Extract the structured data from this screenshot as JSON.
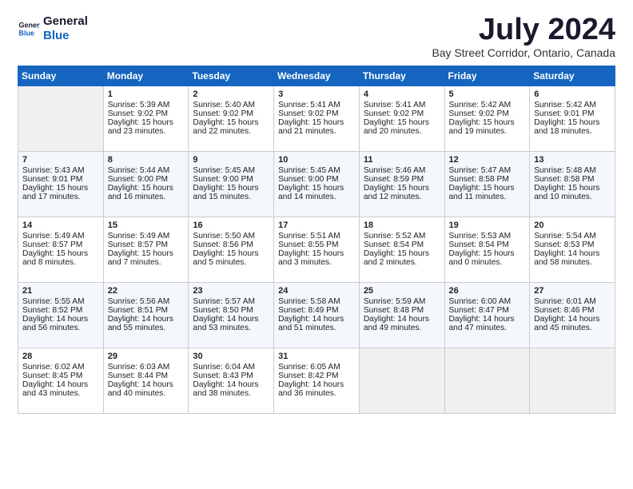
{
  "logo": {
    "line1": "General",
    "line2": "Blue"
  },
  "title": "July 2024",
  "location": "Bay Street Corridor, Ontario, Canada",
  "days_of_week": [
    "Sunday",
    "Monday",
    "Tuesday",
    "Wednesday",
    "Thursday",
    "Friday",
    "Saturday"
  ],
  "weeks": [
    [
      {
        "day": "",
        "content": ""
      },
      {
        "day": "1",
        "sunrise": "Sunrise: 5:39 AM",
        "sunset": "Sunset: 9:02 PM",
        "daylight": "Daylight: 15 hours and 23 minutes."
      },
      {
        "day": "2",
        "sunrise": "Sunrise: 5:40 AM",
        "sunset": "Sunset: 9:02 PM",
        "daylight": "Daylight: 15 hours and 22 minutes."
      },
      {
        "day": "3",
        "sunrise": "Sunrise: 5:41 AM",
        "sunset": "Sunset: 9:02 PM",
        "daylight": "Daylight: 15 hours and 21 minutes."
      },
      {
        "day": "4",
        "sunrise": "Sunrise: 5:41 AM",
        "sunset": "Sunset: 9:02 PM",
        "daylight": "Daylight: 15 hours and 20 minutes."
      },
      {
        "day": "5",
        "sunrise": "Sunrise: 5:42 AM",
        "sunset": "Sunset: 9:02 PM",
        "daylight": "Daylight: 15 hours and 19 minutes."
      },
      {
        "day": "6",
        "sunrise": "Sunrise: 5:42 AM",
        "sunset": "Sunset: 9:01 PM",
        "daylight": "Daylight: 15 hours and 18 minutes."
      }
    ],
    [
      {
        "day": "7",
        "sunrise": "Sunrise: 5:43 AM",
        "sunset": "Sunset: 9:01 PM",
        "daylight": "Daylight: 15 hours and 17 minutes."
      },
      {
        "day": "8",
        "sunrise": "Sunrise: 5:44 AM",
        "sunset": "Sunset: 9:00 PM",
        "daylight": "Daylight: 15 hours and 16 minutes."
      },
      {
        "day": "9",
        "sunrise": "Sunrise: 5:45 AM",
        "sunset": "Sunset: 9:00 PM",
        "daylight": "Daylight: 15 hours and 15 minutes."
      },
      {
        "day": "10",
        "sunrise": "Sunrise: 5:45 AM",
        "sunset": "Sunset: 9:00 PM",
        "daylight": "Daylight: 15 hours and 14 minutes."
      },
      {
        "day": "11",
        "sunrise": "Sunrise: 5:46 AM",
        "sunset": "Sunset: 8:59 PM",
        "daylight": "Daylight: 15 hours and 12 minutes."
      },
      {
        "day": "12",
        "sunrise": "Sunrise: 5:47 AM",
        "sunset": "Sunset: 8:58 PM",
        "daylight": "Daylight: 15 hours and 11 minutes."
      },
      {
        "day": "13",
        "sunrise": "Sunrise: 5:48 AM",
        "sunset": "Sunset: 8:58 PM",
        "daylight": "Daylight: 15 hours and 10 minutes."
      }
    ],
    [
      {
        "day": "14",
        "sunrise": "Sunrise: 5:49 AM",
        "sunset": "Sunset: 8:57 PM",
        "daylight": "Daylight: 15 hours and 8 minutes."
      },
      {
        "day": "15",
        "sunrise": "Sunrise: 5:49 AM",
        "sunset": "Sunset: 8:57 PM",
        "daylight": "Daylight: 15 hours and 7 minutes."
      },
      {
        "day": "16",
        "sunrise": "Sunrise: 5:50 AM",
        "sunset": "Sunset: 8:56 PM",
        "daylight": "Daylight: 15 hours and 5 minutes."
      },
      {
        "day": "17",
        "sunrise": "Sunrise: 5:51 AM",
        "sunset": "Sunset: 8:55 PM",
        "daylight": "Daylight: 15 hours and 3 minutes."
      },
      {
        "day": "18",
        "sunrise": "Sunrise: 5:52 AM",
        "sunset": "Sunset: 8:54 PM",
        "daylight": "Daylight: 15 hours and 2 minutes."
      },
      {
        "day": "19",
        "sunrise": "Sunrise: 5:53 AM",
        "sunset": "Sunset: 8:54 PM",
        "daylight": "Daylight: 15 hours and 0 minutes."
      },
      {
        "day": "20",
        "sunrise": "Sunrise: 5:54 AM",
        "sunset": "Sunset: 8:53 PM",
        "daylight": "Daylight: 14 hours and 58 minutes."
      }
    ],
    [
      {
        "day": "21",
        "sunrise": "Sunrise: 5:55 AM",
        "sunset": "Sunset: 8:52 PM",
        "daylight": "Daylight: 14 hours and 56 minutes."
      },
      {
        "day": "22",
        "sunrise": "Sunrise: 5:56 AM",
        "sunset": "Sunset: 8:51 PM",
        "daylight": "Daylight: 14 hours and 55 minutes."
      },
      {
        "day": "23",
        "sunrise": "Sunrise: 5:57 AM",
        "sunset": "Sunset: 8:50 PM",
        "daylight": "Daylight: 14 hours and 53 minutes."
      },
      {
        "day": "24",
        "sunrise": "Sunrise: 5:58 AM",
        "sunset": "Sunset: 8:49 PM",
        "daylight": "Daylight: 14 hours and 51 minutes."
      },
      {
        "day": "25",
        "sunrise": "Sunrise: 5:59 AM",
        "sunset": "Sunset: 8:48 PM",
        "daylight": "Daylight: 14 hours and 49 minutes."
      },
      {
        "day": "26",
        "sunrise": "Sunrise: 6:00 AM",
        "sunset": "Sunset: 8:47 PM",
        "daylight": "Daylight: 14 hours and 47 minutes."
      },
      {
        "day": "27",
        "sunrise": "Sunrise: 6:01 AM",
        "sunset": "Sunset: 8:46 PM",
        "daylight": "Daylight: 14 hours and 45 minutes."
      }
    ],
    [
      {
        "day": "28",
        "sunrise": "Sunrise: 6:02 AM",
        "sunset": "Sunset: 8:45 PM",
        "daylight": "Daylight: 14 hours and 43 minutes."
      },
      {
        "day": "29",
        "sunrise": "Sunrise: 6:03 AM",
        "sunset": "Sunset: 8:44 PM",
        "daylight": "Daylight: 14 hours and 40 minutes."
      },
      {
        "day": "30",
        "sunrise": "Sunrise: 6:04 AM",
        "sunset": "Sunset: 8:43 PM",
        "daylight": "Daylight: 14 hours and 38 minutes."
      },
      {
        "day": "31",
        "sunrise": "Sunrise: 6:05 AM",
        "sunset": "Sunset: 8:42 PM",
        "daylight": "Daylight: 14 hours and 36 minutes."
      },
      {
        "day": "",
        "content": ""
      },
      {
        "day": "",
        "content": ""
      },
      {
        "day": "",
        "content": ""
      }
    ]
  ]
}
